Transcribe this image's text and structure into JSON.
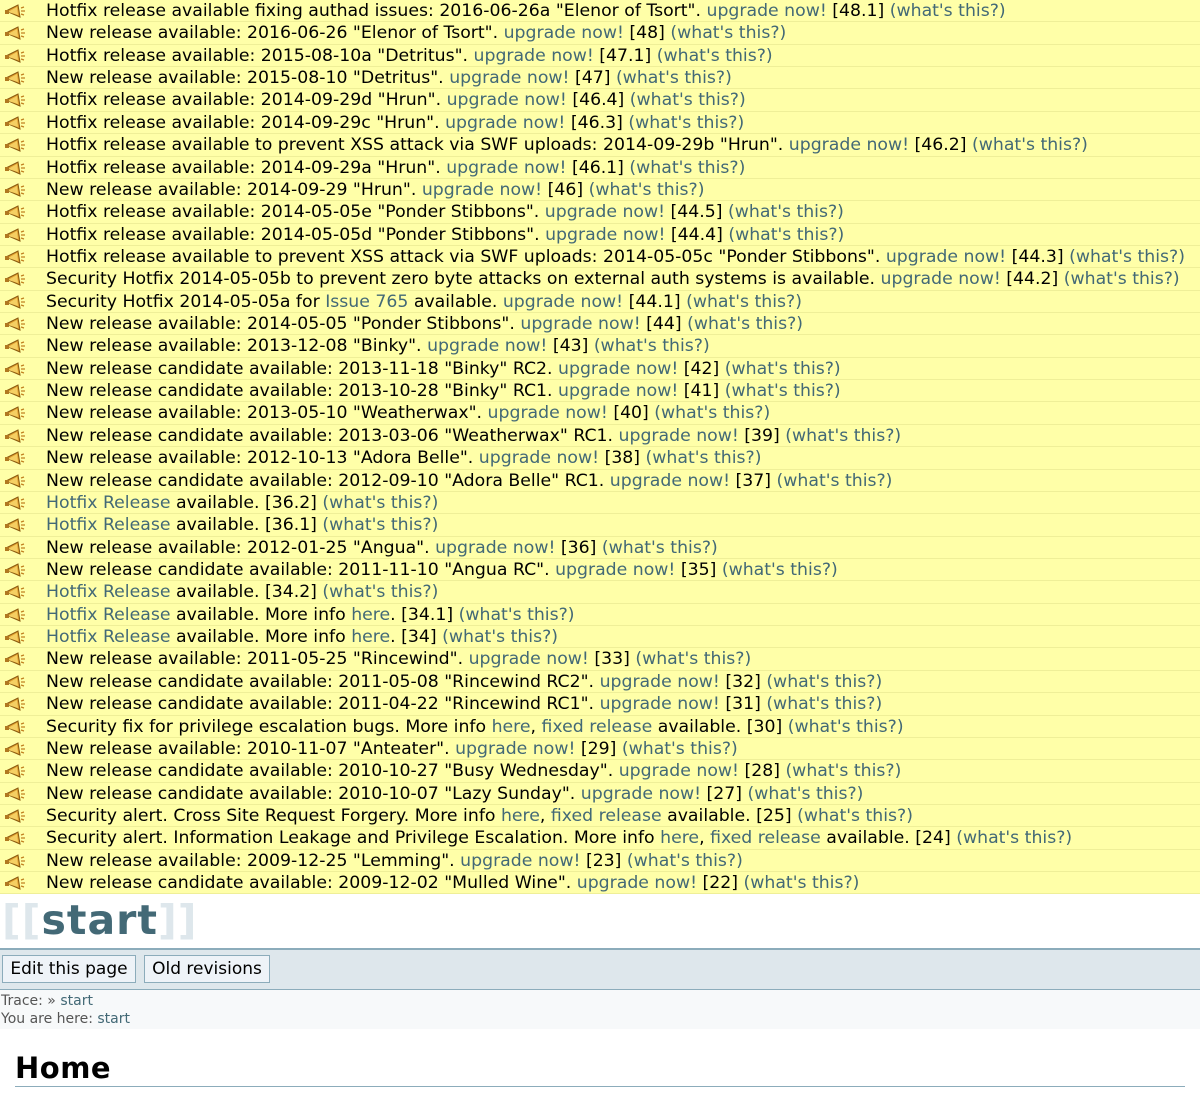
{
  "notices": [
    [
      {
        "t": "Hotfix release available fixing authad issues: 2016-06-26a \"Elenor of Tsort\". "
      },
      {
        "t": "upgrade now!",
        "link": true
      },
      {
        "t": " [48.1] "
      },
      {
        "t": "(what's this?)",
        "link": true
      }
    ],
    [
      {
        "t": "New release available: 2016-06-26 \"Elenor of Tsort\". "
      },
      {
        "t": "upgrade now!",
        "link": true
      },
      {
        "t": " [48] "
      },
      {
        "t": "(what's this?)",
        "link": true
      }
    ],
    [
      {
        "t": "Hotfix release available: 2015-08-10a \"Detritus\". "
      },
      {
        "t": "upgrade now!",
        "link": true
      },
      {
        "t": " [47.1] "
      },
      {
        "t": "(what's this?)",
        "link": true
      }
    ],
    [
      {
        "t": "New release available: 2015-08-10 \"Detritus\". "
      },
      {
        "t": "upgrade now!",
        "link": true
      },
      {
        "t": " [47] "
      },
      {
        "t": "(what's this?)",
        "link": true
      }
    ],
    [
      {
        "t": "Hotfix release available: 2014-09-29d \"Hrun\". "
      },
      {
        "t": "upgrade now!",
        "link": true
      },
      {
        "t": " [46.4] "
      },
      {
        "t": "(what's this?)",
        "link": true
      }
    ],
    [
      {
        "t": "Hotfix release available: 2014-09-29c \"Hrun\". "
      },
      {
        "t": "upgrade now!",
        "link": true
      },
      {
        "t": " [46.3] "
      },
      {
        "t": "(what's this?)",
        "link": true
      }
    ],
    [
      {
        "t": "Hotfix release available to prevent XSS attack via SWF uploads: 2014-09-29b \"Hrun\". "
      },
      {
        "t": "upgrade now!",
        "link": true
      },
      {
        "t": " [46.2] "
      },
      {
        "t": "(what's this?)",
        "link": true
      }
    ],
    [
      {
        "t": "Hotfix release available: 2014-09-29a \"Hrun\". "
      },
      {
        "t": "upgrade now!",
        "link": true
      },
      {
        "t": " [46.1] "
      },
      {
        "t": "(what's this?)",
        "link": true
      }
    ],
    [
      {
        "t": "New release available: 2014-09-29 \"Hrun\". "
      },
      {
        "t": "upgrade now!",
        "link": true
      },
      {
        "t": " [46] "
      },
      {
        "t": "(what's this?)",
        "link": true
      }
    ],
    [
      {
        "t": "Hotfix release available: 2014-05-05e \"Ponder Stibbons\". "
      },
      {
        "t": "upgrade now!",
        "link": true
      },
      {
        "t": " [44.5] "
      },
      {
        "t": "(what's this?)",
        "link": true
      }
    ],
    [
      {
        "t": "Hotfix release available: 2014-05-05d \"Ponder Stibbons\". "
      },
      {
        "t": "upgrade now!",
        "link": true
      },
      {
        "t": " [44.4] "
      },
      {
        "t": "(what's this?)",
        "link": true
      }
    ],
    [
      {
        "t": "Hotfix release available to prevent XSS attack via SWF uploads: 2014-05-05c \"Ponder Stibbons\". "
      },
      {
        "t": "upgrade now!",
        "link": true
      },
      {
        "t": " [44.3] "
      },
      {
        "t": "(what's this?)",
        "link": true
      }
    ],
    [
      {
        "t": "Security Hotfix 2014-05-05b to prevent zero byte attacks on external auth systems is available. "
      },
      {
        "t": "upgrade now!",
        "link": true
      },
      {
        "t": " [44.2] "
      },
      {
        "t": "(what's this?)",
        "link": true
      }
    ],
    [
      {
        "t": "Security Hotfix 2014-05-05a for "
      },
      {
        "t": "Issue 765",
        "link": true
      },
      {
        "t": " available. "
      },
      {
        "t": "upgrade now!",
        "link": true
      },
      {
        "t": " [44.1] "
      },
      {
        "t": "(what's this?)",
        "link": true
      }
    ],
    [
      {
        "t": "New release available: 2014-05-05 \"Ponder Stibbons\". "
      },
      {
        "t": "upgrade now!",
        "link": true
      },
      {
        "t": " [44] "
      },
      {
        "t": "(what's this?)",
        "link": true
      }
    ],
    [
      {
        "t": "New release available: 2013-12-08 \"Binky\". "
      },
      {
        "t": "upgrade now!",
        "link": true
      },
      {
        "t": " [43] "
      },
      {
        "t": "(what's this?)",
        "link": true
      }
    ],
    [
      {
        "t": "New release candidate available: 2013-11-18 \"Binky\" RC2. "
      },
      {
        "t": "upgrade now!",
        "link": true
      },
      {
        "t": " [42] "
      },
      {
        "t": "(what's this?)",
        "link": true
      }
    ],
    [
      {
        "t": "New release candidate available: 2013-10-28 \"Binky\" RC1. "
      },
      {
        "t": "upgrade now!",
        "link": true
      },
      {
        "t": " [41] "
      },
      {
        "t": "(what's this?)",
        "link": true
      }
    ],
    [
      {
        "t": "New release available: 2013-05-10 \"Weatherwax\". "
      },
      {
        "t": "upgrade now!",
        "link": true
      },
      {
        "t": " [40] "
      },
      {
        "t": "(what's this?)",
        "link": true
      }
    ],
    [
      {
        "t": "New release candidate available: 2013-03-06 \"Weatherwax\" RC1. "
      },
      {
        "t": "upgrade now!",
        "link": true
      },
      {
        "t": " [39] "
      },
      {
        "t": "(what's this?)",
        "link": true
      }
    ],
    [
      {
        "t": "New release available: 2012-10-13 \"Adora Belle\". "
      },
      {
        "t": "upgrade now!",
        "link": true
      },
      {
        "t": " [38] "
      },
      {
        "t": "(what's this?)",
        "link": true
      }
    ],
    [
      {
        "t": "New release candidate available: 2012-09-10 \"Adora Belle\" RC1. "
      },
      {
        "t": "upgrade now!",
        "link": true
      },
      {
        "t": " [37] "
      },
      {
        "t": "(what's this?)",
        "link": true
      }
    ],
    [
      {
        "t": "Hotfix Release",
        "link": true
      },
      {
        "t": " available. [36.2] "
      },
      {
        "t": "(what's this?)",
        "link": true
      }
    ],
    [
      {
        "t": "Hotfix Release",
        "link": true
      },
      {
        "t": " available. [36.1] "
      },
      {
        "t": "(what's this?)",
        "link": true
      }
    ],
    [
      {
        "t": "New release available: 2012-01-25 \"Angua\". "
      },
      {
        "t": "upgrade now!",
        "link": true
      },
      {
        "t": " [36] "
      },
      {
        "t": "(what's this?)",
        "link": true
      }
    ],
    [
      {
        "t": "New release candidate available: 2011-11-10 \"Angua RC\". "
      },
      {
        "t": "upgrade now!",
        "link": true
      },
      {
        "t": " [35] "
      },
      {
        "t": "(what's this?)",
        "link": true
      }
    ],
    [
      {
        "t": "Hotfix Release",
        "link": true
      },
      {
        "t": " available. [34.2] "
      },
      {
        "t": "(what's this?)",
        "link": true
      }
    ],
    [
      {
        "t": "Hotfix Release",
        "link": true
      },
      {
        "t": " available. More info "
      },
      {
        "t": "here",
        "link": true
      },
      {
        "t": ". [34.1] "
      },
      {
        "t": "(what's this?)",
        "link": true
      }
    ],
    [
      {
        "t": "Hotfix Release",
        "link": true
      },
      {
        "t": " available. More info "
      },
      {
        "t": "here",
        "link": true
      },
      {
        "t": ". [34] "
      },
      {
        "t": "(what's this?)",
        "link": true
      }
    ],
    [
      {
        "t": "New release available: 2011-05-25 \"Rincewind\". "
      },
      {
        "t": "upgrade now!",
        "link": true
      },
      {
        "t": " [33] "
      },
      {
        "t": "(what's this?)",
        "link": true
      }
    ],
    [
      {
        "t": "New release candidate available: 2011-05-08 \"Rincewind RC2\". "
      },
      {
        "t": "upgrade now!",
        "link": true
      },
      {
        "t": " [32] "
      },
      {
        "t": "(what's this?)",
        "link": true
      }
    ],
    [
      {
        "t": "New release candidate available: 2011-04-22 \"Rincewind RC1\". "
      },
      {
        "t": "upgrade now!",
        "link": true
      },
      {
        "t": " [31] "
      },
      {
        "t": "(what's this?)",
        "link": true
      }
    ],
    [
      {
        "t": "Security fix for privilege escalation bugs. More info "
      },
      {
        "t": "here",
        "link": true
      },
      {
        "t": ", "
      },
      {
        "t": "fixed release",
        "link": true
      },
      {
        "t": " available. [30] "
      },
      {
        "t": "(what's this?)",
        "link": true
      }
    ],
    [
      {
        "t": "New release available: 2010-11-07 \"Anteater\". "
      },
      {
        "t": "upgrade now!",
        "link": true
      },
      {
        "t": " [29] "
      },
      {
        "t": "(what's this?)",
        "link": true
      }
    ],
    [
      {
        "t": "New release candidate available: 2010-10-27 \"Busy Wednesday\". "
      },
      {
        "t": "upgrade now!",
        "link": true
      },
      {
        "t": " [28] "
      },
      {
        "t": "(what's this?)",
        "link": true
      }
    ],
    [
      {
        "t": "New release candidate available: 2010-10-07 \"Lazy Sunday\". "
      },
      {
        "t": "upgrade now!",
        "link": true
      },
      {
        "t": " [27] "
      },
      {
        "t": "(what's this?)",
        "link": true
      }
    ],
    [
      {
        "t": "Security alert. Cross Site Request Forgery. More info "
      },
      {
        "t": "here",
        "link": true
      },
      {
        "t": ", "
      },
      {
        "t": "fixed release",
        "link": true
      },
      {
        "t": " available. [25] "
      },
      {
        "t": "(what's this?)",
        "link": true
      }
    ],
    [
      {
        "t": "Security alert. Information Leakage and Privilege Escalation. More info "
      },
      {
        "t": "here",
        "link": true
      },
      {
        "t": ", "
      },
      {
        "t": "fixed release",
        "link": true
      },
      {
        "t": " available. [24] "
      },
      {
        "t": "(what's this?)",
        "link": true
      }
    ],
    [
      {
        "t": "New release available: 2009-12-25 \"Lemming\". "
      },
      {
        "t": "upgrade now!",
        "link": true
      },
      {
        "t": " [23] "
      },
      {
        "t": "(what's this?)",
        "link": true
      }
    ],
    [
      {
        "t": "New release candidate available: 2009-12-02 \"Mulled Wine\". "
      },
      {
        "t": "upgrade now!",
        "link": true
      },
      {
        "t": " [22] "
      },
      {
        "t": "(what's this?)",
        "link": true
      }
    ]
  ],
  "notice_icon": "megaphone-icon",
  "header": {
    "logo_open": "[[",
    "logo_name": "start",
    "logo_close": "]]"
  },
  "toolbar": {
    "edit_label": "Edit this page",
    "revisions_label": "Old revisions"
  },
  "breadcrumbs": {
    "trace_label": "Trace:",
    "trace_sep": " » ",
    "trace_link": "start",
    "here_label": "You are here:",
    "here_link": "start"
  },
  "page": {
    "heading": "Home"
  },
  "colors": {
    "notice_bg": "#ffffa8",
    "link": "#436976",
    "bar_bg": "#dee7ec"
  }
}
